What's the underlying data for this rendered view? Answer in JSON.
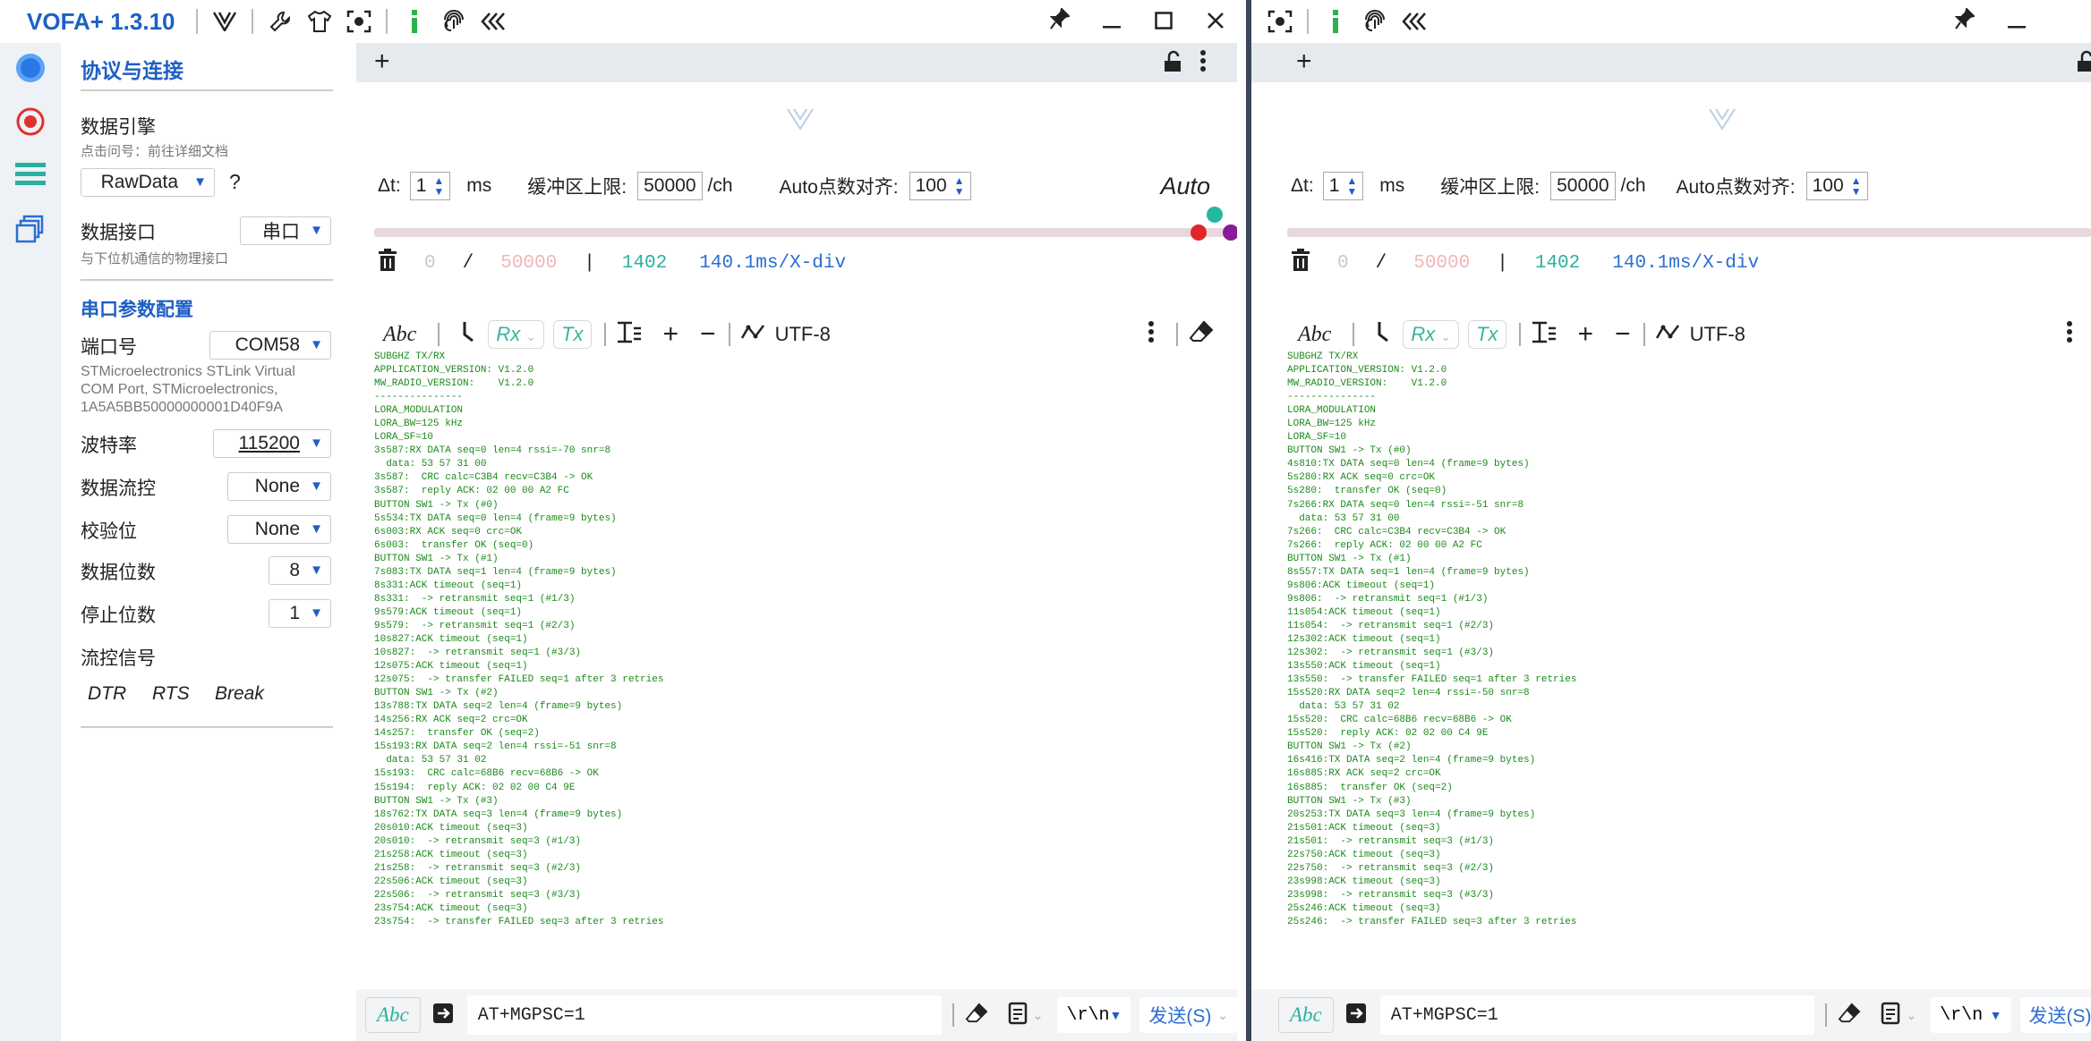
{
  "app": {
    "title": "VOFA+ 1.3.10"
  },
  "sidebar": {
    "section_title": "协议与连接"
  },
  "engine": {
    "label": "数据引擎",
    "hint": "点击问号：前往详细文档",
    "value": "RawData",
    "help": "?"
  },
  "iface": {
    "label": "数据接口",
    "value": "串口",
    "hint": "与下位机通信的物理接口"
  },
  "serial": {
    "title": "串口参数配置",
    "port_label": "端口号",
    "port_value": "COM58",
    "port_desc": "STMicroelectronics STLink Virtual COM Port, STMicroelectronics, 1A5A5BB50000000001D40F9A",
    "baud_label": "波特率",
    "baud_value": "115200",
    "flow_label": "数据流控",
    "flow_value": "None",
    "parity_label": "校验位",
    "parity_value": "None",
    "databits_label": "数据位数",
    "databits_value": "8",
    "stopbits_label": "停止位数",
    "stopbits_value": "1",
    "flowsig_label": "流控信号",
    "dtr": "DTR",
    "rts": "RTS",
    "brk": "Break"
  },
  "controls": {
    "dt_label": "Δt:",
    "dt_value": "1",
    "dt_unit": "ms",
    "buf_label": "缓冲区上限:",
    "buf_value": "50000",
    "buf_unit": "/ch",
    "align_label": "Auto点数对齐:",
    "align_value": "100",
    "auto": "Auto"
  },
  "stats": {
    "cur": "0",
    "slash": "/",
    "max": "50000",
    "bar": "|",
    "count": "1402",
    "xdiv": "140.1ms/X-div"
  },
  "toolbar": {
    "abc": "Abc",
    "rx": "Rx",
    "tx": "Tx",
    "encoding": "UTF-8"
  },
  "send": {
    "abc": "Abc",
    "input": "AT+MGPSC=1",
    "eol": "\\r\\n",
    "button": "发送(S)"
  },
  "logs": {
    "left": "SUBGHZ TX/RX\nAPPLICATION_VERSION: V1.2.0\nMW_RADIO_VERSION:    V1.2.0\n---------------\nLORA_MODULATION\nLORA_BW=125 kHz\nLORA_SF=10\n3s587:RX DATA seq=0 len=4 rssi=-70 snr=8\n  data: 53 57 31 00\n3s587:  CRC calc=C3B4 recv=C3B4 -> OK\n3s587:  reply ACK: 02 00 00 A2 FC\nBUTTON SW1 -> Tx (#0)\n5s534:TX DATA seq=0 len=4 (frame=9 bytes)\n6s003:RX ACK seq=0 crc=OK\n6s003:  transfer OK (seq=0)\nBUTTON SW1 -> Tx (#1)\n7s083:TX DATA seq=1 len=4 (frame=9 bytes)\n8s331:ACK timeout (seq=1)\n8s331:  -> retransmit seq=1 (#1/3)\n9s579:ACK timeout (seq=1)\n9s579:  -> retransmit seq=1 (#2/3)\n10s827:ACK timeout (seq=1)\n10s827:  -> retransmit seq=1 (#3/3)\n12s075:ACK timeout (seq=1)\n12s075:  -> transfer FAILED seq=1 after 3 retries\nBUTTON SW1 -> Tx (#2)\n13s788:TX DATA seq=2 len=4 (frame=9 bytes)\n14s256:RX ACK seq=2 crc=OK\n14s257:  transfer OK (seq=2)\n15s193:RX DATA seq=2 len=4 rssi=-51 snr=8\n  data: 53 57 31 02\n15s193:  CRC calc=68B6 recv=68B6 -> OK\n15s194:  reply ACK: 02 02 00 C4 9E\nBUTTON SW1 -> Tx (#3)\n18s762:TX DATA seq=3 len=4 (frame=9 bytes)\n20s010:ACK timeout (seq=3)\n20s010:  -> retransmit seq=3 (#1/3)\n21s258:ACK timeout (seq=3)\n21s258:  -> retransmit seq=3 (#2/3)\n22s506:ACK timeout (seq=3)\n22s506:  -> retransmit seq=3 (#3/3)\n23s754:ACK timeout (seq=3)\n23s754:  -> transfer FAILED seq=3 after 3 retries",
    "right": "SUBGHZ TX/RX\nAPPLICATION_VERSION: V1.2.0\nMW_RADIO_VERSION:    V1.2.0\n---------------\nLORA_MODULATION\nLORA_BW=125 kHz\nLORA_SF=10\nBUTTON SW1 -> Tx (#0)\n4s810:TX DATA seq=0 len=4 (frame=9 bytes)\n5s280:RX ACK seq=0 crc=OK\n5s280:  transfer OK (seq=0)\n7s266:RX DATA seq=0 len=4 rssi=-51 snr=8\n  data: 53 57 31 00\n7s266:  CRC calc=C3B4 recv=C3B4 -> OK\n7s266:  reply ACK: 02 00 00 A2 FC\nBUTTON SW1 -> Tx (#1)\n8s557:TX DATA seq=1 len=4 (frame=9 bytes)\n9s806:ACK timeout (seq=1)\n9s806:  -> retransmit seq=1 (#1/3)\n11s054:ACK timeout (seq=1)\n11s054:  -> retransmit seq=1 (#2/3)\n12s302:ACK timeout (seq=1)\n12s302:  -> retransmit seq=1 (#3/3)\n13s550:ACK timeout (seq=1)\n13s550:  -> transfer FAILED seq=1 after 3 retries\n15s520:RX DATA seq=2 len=4 rssi=-50 snr=8\n  data: 53 57 31 02\n15s520:  CRC calc=68B6 recv=68B6 -> OK\n15s520:  reply ACK: 02 02 00 C4 9E\nBUTTON SW1 -> Tx (#2)\n16s416:TX DATA seq=2 len=4 (frame=9 bytes)\n16s885:RX ACK seq=2 crc=OK\n16s885:  transfer OK (seq=2)\nBUTTON SW1 -> Tx (#3)\n20s253:TX DATA seq=3 len=4 (frame=9 bytes)\n21s501:ACK timeout (seq=3)\n21s501:  -> retransmit seq=3 (#1/3)\n22s750:ACK timeout (seq=3)\n22s750:  -> retransmit seq=3 (#2/3)\n23s998:ACK timeout (seq=3)\n23s998:  -> retransmit seq=3 (#3/3)\n25s246:ACK timeout (seq=3)\n25s246:  -> transfer FAILED seq=3 after 3 retries"
  },
  "colors": {
    "brand": "#1e5fc4",
    "log_text": "#1c8a1c",
    "teal": "#3bb3a0"
  }
}
